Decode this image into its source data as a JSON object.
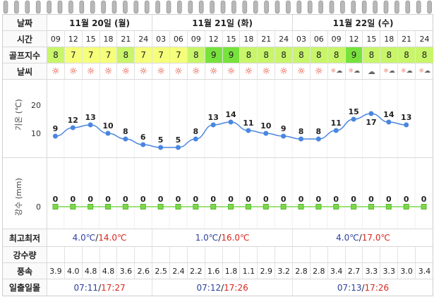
{
  "labels": {
    "date": "날짜",
    "time": "시간",
    "golf": "골프지수",
    "weather": "날씨",
    "temp_axis": "기온 (℃)",
    "rain_axis": "강수 (mm)",
    "minmax": "최고최저",
    "rain_amount": "강수량",
    "wind": "풍속",
    "sun": "일출일몰"
  },
  "days": [
    {
      "label": "11월 20일 (월)",
      "span": 6,
      "min": "4.0℃",
      "max": "14.0℃",
      "sunrise": "07:11",
      "sunset": "17:27"
    },
    {
      "label": "11월 21일 (화)",
      "span": 8,
      "min": "1.0℃",
      "max": "16.0℃",
      "sunrise": "07:12",
      "sunset": "17:26"
    },
    {
      "label": "11월 22일 (수)",
      "span": 8,
      "min": "4.0℃",
      "max": "17.0℃",
      "sunrise": "07:13",
      "sunset": "17:26"
    }
  ],
  "minmax_sep": "/",
  "sun_sep": "/",
  "hours": [
    "09",
    "12",
    "15",
    "18",
    "21",
    "24",
    "03",
    "06",
    "09",
    "12",
    "15",
    "18",
    "21",
    "24",
    "03",
    "06",
    "09",
    "12",
    "15",
    "18",
    "21",
    "24"
  ],
  "golf_index": [
    "8",
    "7",
    "7",
    "7",
    "8",
    "7",
    "7",
    "7",
    "8",
    "9",
    "9",
    "8",
    "8",
    "8",
    "8",
    "8",
    "8",
    "9",
    "8",
    "8",
    "8",
    "8"
  ],
  "weather_icons": [
    "sun-icon",
    "sun-icon",
    "sun-icon",
    "sun-icon",
    "sun-icon",
    "sun-icon",
    "sun-icon",
    "sun-icon",
    "sun-icon",
    "sun-icon",
    "sun-icon",
    "sun-icon",
    "sun-icon",
    "sun-icon",
    "sun-icon",
    "sun-icon",
    "sun-cloud-icon",
    "sun-cloud-icon",
    "cloud-icon",
    "sun-cloud-icon",
    "sun-cloud-icon",
    "sun-cloud-icon"
  ],
  "wind": [
    "3.9",
    "4.0",
    "4.8",
    "4.8",
    "3.6",
    "2.6",
    "2.5",
    "2.4",
    "2.2",
    "1.6",
    "1.8",
    "1.1",
    "2.9",
    "3.2",
    "2.8",
    "2.8",
    "3.4",
    "2.7",
    "3.3",
    "3.3",
    "3.0",
    "3.4"
  ],
  "golf_colors": {
    "7": "#f6ff7a",
    "8": "#c8f56a",
    "9": "#78e23d"
  },
  "chart_data": [
    {
      "type": "line",
      "x": [
        "09",
        "12",
        "15",
        "18",
        "21",
        "24",
        "03",
        "06",
        "09",
        "12",
        "15",
        "18",
        "21",
        "24",
        "03",
        "06",
        "09",
        "12",
        "15",
        "18",
        "21",
        "24"
      ],
      "values": [
        9,
        12,
        13,
        10,
        8,
        6,
        5,
        5,
        8,
        13,
        14,
        11,
        10,
        9,
        8,
        8,
        11,
        15,
        17,
        14,
        13
      ],
      "ylabel": "기온 (℃)",
      "yticks": [
        "20",
        "10",
        "0"
      ],
      "ylim": [
        0,
        20
      ],
      "color": "#4a86e0"
    },
    {
      "type": "line",
      "x": [
        "09",
        "12",
        "15",
        "18",
        "21",
        "24",
        "03",
        "06",
        "09",
        "12",
        "15",
        "18",
        "21",
        "24",
        "03",
        "06",
        "09",
        "12",
        "15",
        "18",
        "21",
        "24"
      ],
      "values": [
        0,
        0,
        0,
        0,
        0,
        0,
        0,
        0,
        0,
        0,
        0,
        0,
        0,
        0,
        0,
        0,
        0,
        0,
        0,
        0,
        0,
        0
      ],
      "ylabel": "강수 (mm)",
      "yticks": [
        "0"
      ],
      "color": "#7cd84a"
    }
  ]
}
